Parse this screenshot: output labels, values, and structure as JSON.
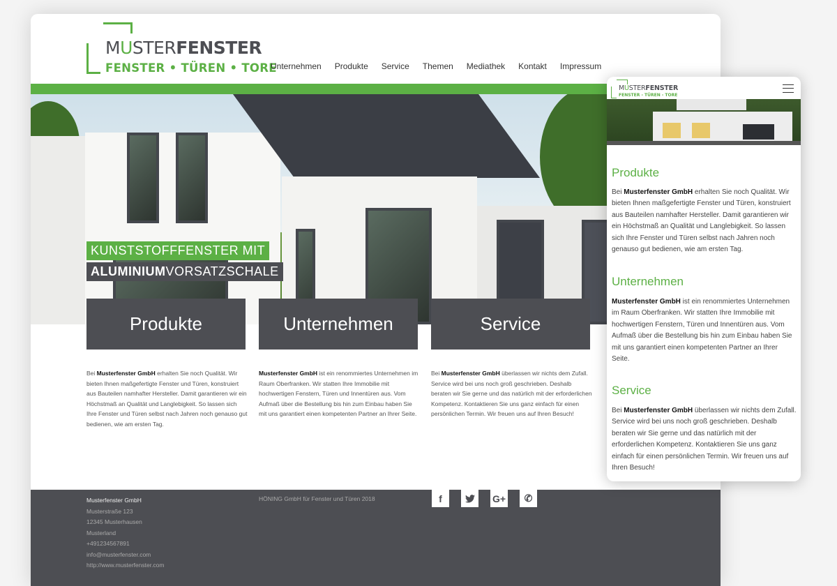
{
  "brand": {
    "name_pre": "M",
    "name_u": "U",
    "name_mid": "STER",
    "name_bold": "FENSTER",
    "tagline": "FENSTER • TÜREN • TORE",
    "mobile_tagline": "FENSTER - TÜREN - TORE",
    "accent": "#5cb045",
    "dark": "#4d4e53"
  },
  "nav": [
    "Unternehmen",
    "Produkte",
    "Service",
    "Themen",
    "Mediathek",
    "Kontakt",
    "Impressum"
  ],
  "hero": {
    "line1": "KUNSTSTOFFFENSTER MIT",
    "line2_bold": "ALUMINIUM",
    "line2_rest": "VORSATZSCHALE"
  },
  "sections": [
    {
      "title": "Produkte",
      "pre": "Bei ",
      "bold": "Musterfenster GmbH",
      "post": " erhalten Sie noch Qualität. Wir bieten Ihnen maßgefertigte Fenster und Türen, konstruiert aus Bauteilen namhafter Hersteller. Damit garantieren wir ein Höchstmaß an Qualität und Langlebigkeit. So lassen sich Ihre Fenster und Türen selbst nach Jahren noch genauso gut bedienen, wie am ersten Tag."
    },
    {
      "title": "Unternehmen",
      "pre": "",
      "bold": "Musterfenster GmbH",
      "post": " ist ein renommiertes Unternehmen im Raum Oberfranken. Wir statten Ihre Immobilie mit hochwertigen Fenstern, Türen und Innentüren aus. Vom Aufmaß über die Bestellung bis hin zum Einbau haben Sie mit uns garantiert einen kompetenten Partner an Ihrer Seite."
    },
    {
      "title": "Service",
      "pre": "Bei ",
      "bold": "Musterfenster GmbH",
      "post": " überlassen wir nichts dem Zufall. Service wird bei uns noch groß geschrieben. Deshalb beraten wir Sie gerne und das natürlich mit der erforderlichen Kompetenz. Kontaktieren Sie uns ganz einfach für einen persönlichen Termin. Wir freuen uns auf Ihren Besuch!"
    }
  ],
  "footer": {
    "address": [
      "Musterfenster GmbH",
      "Musterstraße 123",
      "12345 Musterhausen",
      "Musterland",
      "+491234567891",
      "info@musterfenster.com",
      "http://www.musterfenster.com"
    ],
    "copyright": "HÖNING GmbH für Fenster und Türen 2018",
    "social": [
      {
        "icon": "facebook-icon",
        "glyph": "f"
      },
      {
        "icon": "twitter-icon",
        "glyph": ""
      },
      {
        "icon": "google-plus-icon",
        "glyph": "G+"
      },
      {
        "icon": "whatsapp-icon",
        "glyph": "✆"
      }
    ]
  }
}
